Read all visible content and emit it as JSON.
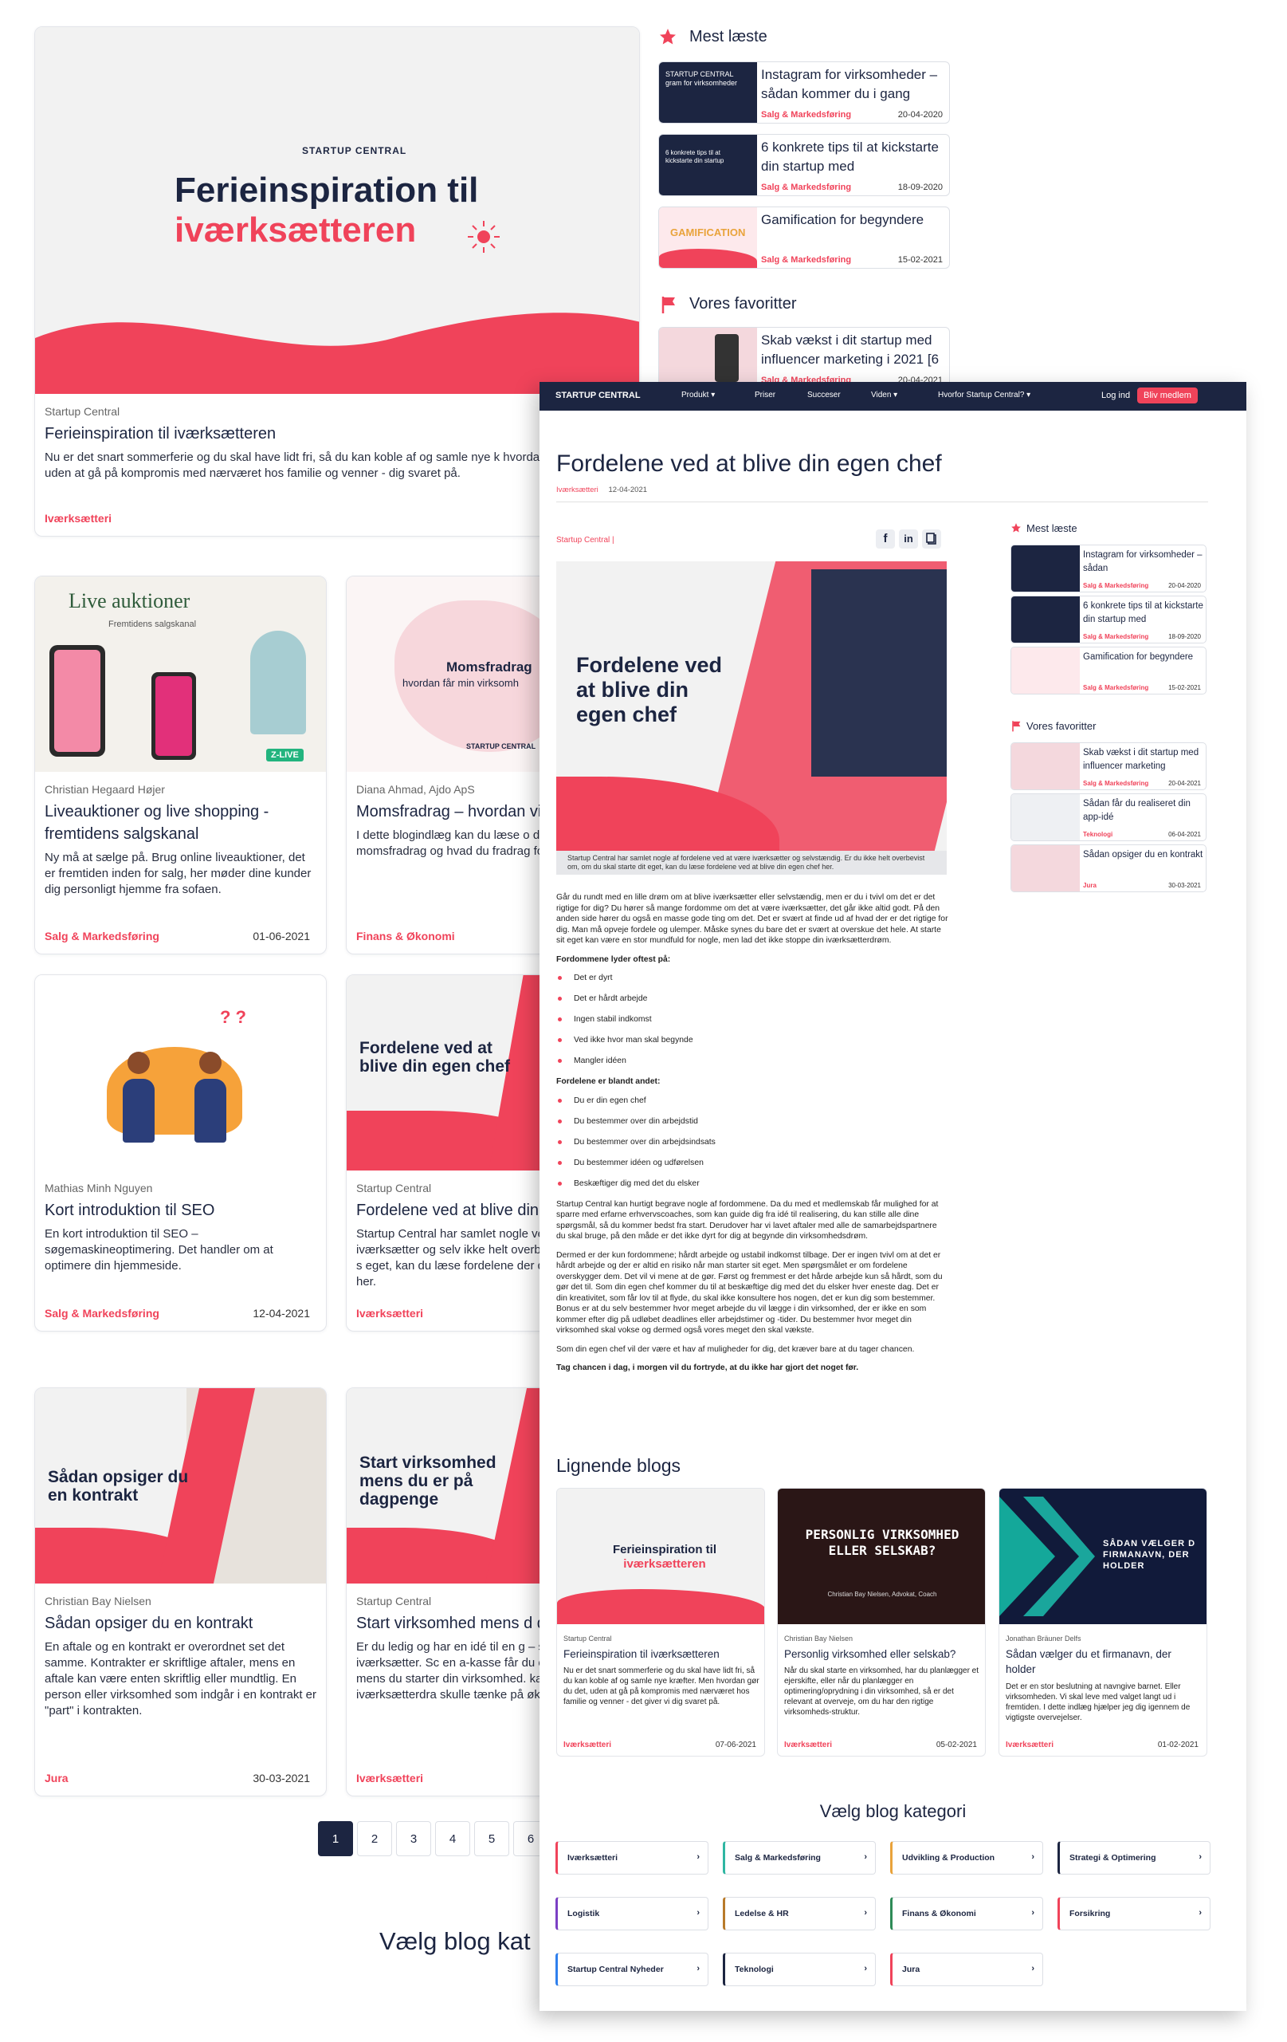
{
  "hero": {
    "brand": "STARTUP CENTRAL",
    "title_l1": "Ferieinspiration til",
    "title_l2": "iværksætteren",
    "author": "Startup Central",
    "title": "Ferieinspiration til iværksætteren",
    "excerpt": "Nu er det snart sommerferie og du skal have lidt fri, så du kan koble af og samle nye k hvordan gør du det, uden at gå på kompromis med nærværet hos familie og venner - dig svaret på.",
    "category": "Iværksætteri"
  },
  "sidebar": {
    "most_read_title": "Mest læste",
    "most_read": [
      {
        "title": "Instagram for virksomheder – sådan kommer du i gang",
        "category": "Salg & Markedsføring",
        "date": "20-04-2020"
      },
      {
        "title": "6 konkrete tips til at kickstarte din startup med",
        "category": "Salg & Markedsføring",
        "date": "18-09-2020"
      },
      {
        "title": "Gamification for begyndere",
        "category": "Salg & Markedsføring",
        "date": "15-02-2021"
      }
    ],
    "fav_title": "Vores favoritter",
    "favs": [
      {
        "title": "Skab vækst i dit startup med influencer marketing i 2021 [6",
        "category": "Salg & Markedsføring",
        "date": "20-04-2021"
      }
    ]
  },
  "cards": [
    {
      "thumb": "Live auktioner",
      "thumb_sub": "Fremtidens salgskanal",
      "thumb_badge": "Z-LIVE",
      "author": "Christian Hegaard Højer",
      "title": "Liveauktioner og live shopping - fremtidens salgskanal",
      "excerpt": "Ny må at sælge på. Brug online liveauktioner, det er fremtiden inden for salg, her møder dine kunder dig personligt hjemme fra sofaen.",
      "category": "Salg & Markedsføring",
      "date": "01-06-2021"
    },
    {
      "thumb": "Momsfradrag",
      "thumb_sub": "hvordan får min virksomh",
      "author": "Diana Ahmad, Ajdo ApS",
      "title": "Momsfradrag – hvordan virksomhed det?",
      "excerpt": "I dette blogindlæg kan du læse o du får momsfradrag og hvad du fradrag for.",
      "category": "Finans & Økonomi",
      "date": ""
    },
    {
      "author": "Mathias Minh Nguyen",
      "title": "Kort introduktion til SEO",
      "excerpt": "En kort introduktion til SEO – søgemaskineoptimering. Det handler om at optimere din hjemmeside.",
      "category": "Salg & Markedsføring",
      "date": "12-04-2021"
    },
    {
      "thumb": "Fordelene ved at blive din egen chef",
      "author": "Startup Central",
      "title": "Fordelene ved at blive din chef",
      "excerpt": "Startup Central har samlet nogle ved at være iværksætter og selv ikke helt overbevist om, om du s eget, kan du læse fordelene der din egen chef her.",
      "category": "Iværksætteri",
      "date": ""
    },
    {
      "thumb": "Sådan opsiger du en kontrakt",
      "author": "Christian Bay Nielsen",
      "title": "Sådan opsiger du en kontrakt",
      "excerpt": "En aftale og en kontrakt er overordnet set det samme. Kontrakter er skriftlige aftaler, mens en aftale kan være enten skriftlig eller mundtlig. En person eller virksomhed som indgår i en kontrakt er \"part\" i kontrakten.",
      "category": "Jura",
      "date": "30-03-2021"
    },
    {
      "thumb": "Start virksomhed mens du er på dagpenge",
      "author": "Startup Central",
      "title": "Start virksomhed mens d dagpenge",
      "excerpt": "Er du ledig og har en idé til en g – så skal du blive iværksætter. Sc en a-kasse får du et økonomisk mens du starter din virksomhed. kan du prøve din iværksætterdra skulle tænke på økonomien.",
      "category": "Iværksætteri",
      "date": ""
    }
  ],
  "pagination": [
    "1",
    "2",
    "3",
    "4",
    "5",
    "6"
  ],
  "bottom_heading": "Vælg blog kat",
  "overlay": {
    "nav": {
      "brand": "STARTUP CENTRAL",
      "items": [
        "Produkt ▾",
        "Priser",
        "Succeser",
        "Viden ▾",
        "Hvorfor Startup Central? ▾"
      ],
      "login": "Log ind",
      "cta": "Bliv medlem"
    },
    "title": "Fordelene ved at blive din egen chef",
    "category": "Iværksætteri",
    "date": "12-04-2021",
    "author": "Startup Central |",
    "hero_l1": "Fordelene ved",
    "hero_l2": "at blive din",
    "hero_l3": "egen chef",
    "caption": "Startup Central har samlet nogle af fordelene ved at være iværksætter og selvstændig. Er du ikke helt overbevist om, om du skal starte dit eget, kan du læse fordelene ved at blive din egen chef her.",
    "p1": "Går du rundt med en lille drøm om at blive iværksætter eller selvstændig, men er du i tvivl om det er det rigtige for dig? Du hører så mange fordomme om det at være iværksætter, det går ikke altid godt. På den anden side hører du også en masse gode ting om det. Det er svært at finde ud af hvad der er det rigtige for dig. Man må opveje fordele og ulemper. Måske synes du bare det er svært at overskue det hele. At starte sit eget kan være en stor mundfuld for nogle, men lad det ikke stoppe din iværksætterdrøm.",
    "h1": "Fordommene lyder oftest på:",
    "l1": [
      "Det er dyrt",
      "Det er hårdt arbejde",
      "Ingen stabil indkomst",
      "Ved ikke hvor man skal begynde",
      "Mangler idéen"
    ],
    "h2": "Fordelene er blandt andet:",
    "l2": [
      "Du er din egen chef",
      "Du bestemmer over din arbejdstid",
      "Du bestemmer over din arbejdsindsats",
      "Du bestemmer idéen og udførelsen",
      "Beskæftiger dig med det du elsker"
    ],
    "p2": "Startup Central kan hurtigt begrave nogle af fordommene. Da du med et medlemskab får mulighed for at sparre med erfarne erhvervscoaches, som kan guide dig fra idé til realisering, du kan stille alle dine spørgsmål, så du kommer bedst fra start. Derudover har vi lavet aftaler med alle de samarbejdspartnere du skal bruge, på den måde er det ikke dyrt for dig at begynde din virksomhedsdrøm.",
    "p3": "Dermed er der kun fordommene; hårdt arbejde og ustabil indkomst tilbage. Der er ingen tvivl om at det er hårdt arbejde og der er altid en risiko når man starter sit eget. Men spørgsmålet er om fordelene overskygger dem. Det vil vi mene at de gør. Først og fremmest er det hårde arbejde kun så hårdt, som du gør det til. Som din egen chef kommer du til at beskæftige dig med det du elsker hver eneste dag. Det er din kreativitet, som får lov til at flyde, du skal ikke konsultere hos nogen, det er kun dig som bestemmer. Bonus er at du selv bestemmer hvor meget arbejde du vil lægge i din virksomhed, der er ikke en som kommer efter dig på udløbet deadlines eller arbejdstimer og -tider. Du bestemmer hvor meget din virksomhed skal vokse og dermed også vores meget den skal vækste.",
    "p4": "Som din egen chef vil der være et hav af muligheder for dig, det kræver bare at du tager chancen.",
    "p5": "Tag chancen i dag, i morgen vil du fortryde, at du ikke har gjort det noget før.",
    "similar_heading": "Lignende blogs",
    "similar": [
      {
        "thumb_l1": "Ferieinspiration til",
        "thumb_l2": "iværksætteren",
        "author": "Startup Central",
        "title": "Ferieinspiration til iværksætteren",
        "excerpt": "Nu er det snart sommerferie og du skal have lidt fri, så du kan koble af og samle nye kræfter. Men hvordan gør du det, uden at gå på kompromis med nærværet hos familie og venner - det giver vi dig svaret på.",
        "category": "Iværksætteri",
        "date": "07-06-2021"
      },
      {
        "thumb_l1": "PERSONLIG VIRKSOMHED",
        "thumb_l2": "ELLER SELSKAB?",
        "thumb_sub": "Christian Bay Nielsen, Advokat, Coach",
        "author": "Christian Bay Nielsen",
        "title": "Personlig virksomhed eller selskab?",
        "excerpt": "Når du skal starte en virksomhed, har du planlægger et ejerskifte, eller når du planlægger en optimering/oprydning i din virksomhed, så er det relevant at overveje, om du har den rigtige virksomheds-struktur.",
        "category": "Iværksætteri",
        "date": "05-02-2021"
      },
      {
        "thumb_l1": "SÅDAN VÆLGER D",
        "thumb_l2": "FIRMANAVN, DER",
        "thumb_l3": "HOLDER",
        "author": "Jonathan Bräuner Delfs",
        "title": "Sådan vælger du et firmanavn, der holder",
        "excerpt": "Det er en stor beslutning at navngive barnet. Eller virksomheden. Vi skal leve med valget langt ud i fremtiden. I dette indlæg hjælper jeg dig igennem de vigtigste overvejelser.",
        "category": "Iværksætteri",
        "date": "01-02-2021"
      }
    ],
    "cat_heading": "Vælg blog kategori",
    "categories": [
      {
        "label": "Iværksætteri",
        "color": "#f0435a"
      },
      {
        "label": "Salg & Markedsføring",
        "color": "#2fb6a2"
      },
      {
        "label": "Udvikling & Production",
        "color": "#e9a33b"
      },
      {
        "label": "Strategi & Optimering",
        "color": "#1c2541"
      },
      {
        "label": "Logistik",
        "color": "#7b3fc4"
      },
      {
        "label": "Ledelse & HR",
        "color": "#b87a2a"
      },
      {
        "label": "Finans & Økonomi",
        "color": "#2e8b57"
      },
      {
        "label": "Forsikring",
        "color": "#f0435a"
      },
      {
        "label": "Startup Central Nyheder",
        "color": "#2f80ed"
      },
      {
        "label": "Teknologi",
        "color": "#1c2541"
      },
      {
        "label": "Jura",
        "color": "#f0435a"
      }
    ],
    "sidebar": {
      "most_read_title": "Mest læste",
      "most_read": [
        {
          "title": "Instagram for virksomheder – sådan",
          "category": "Salg & Markedsføring",
          "date": "20-04-2020"
        },
        {
          "title": "6 konkrete tips til at kickstarte din startup med",
          "category": "Salg & Markedsføring",
          "date": "18-09-2020"
        },
        {
          "title": "Gamification for begyndere",
          "category": "Salg & Markedsføring",
          "date": "15-02-2021"
        }
      ],
      "fav_title": "Vores favoritter",
      "favs": [
        {
          "title": "Skab vækst i dit startup med influencer marketing",
          "category": "Salg & Markedsføring",
          "date": "20-04-2021"
        },
        {
          "title": "Sådan får du realiseret din app-idé",
          "category": "Teknologi",
          "date": "06-04-2021"
        },
        {
          "title": "Sådan opsiger du en kontrakt",
          "category": "Jura",
          "date": "30-03-2021"
        }
      ]
    }
  },
  "colors": {
    "brand_red": "#f0435a",
    "navy": "#1c2541"
  }
}
